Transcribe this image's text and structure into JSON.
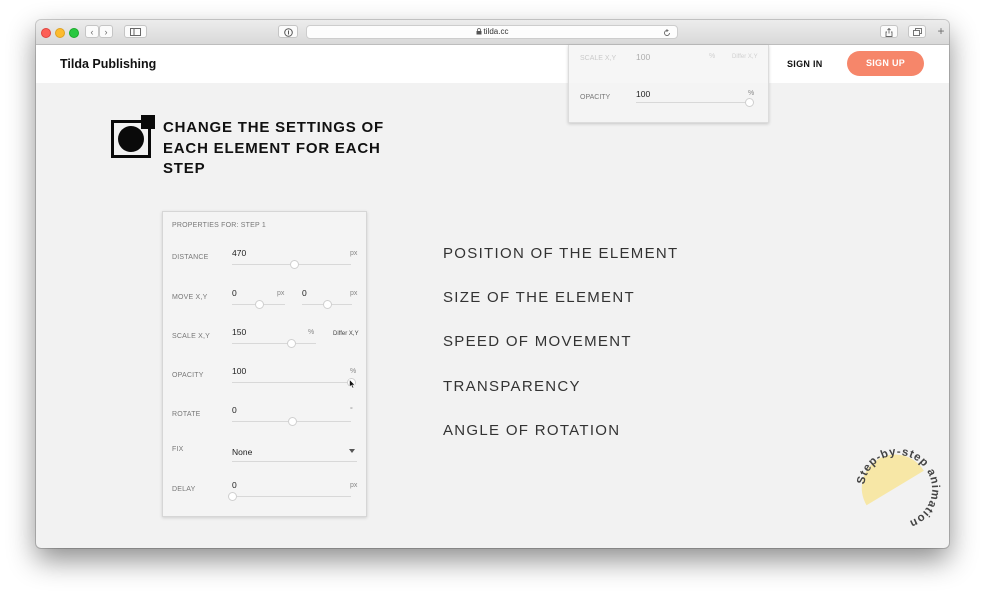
{
  "browser": {
    "url": "tilda.cc"
  },
  "header": {
    "brand": "Tilda Publishing",
    "sign_in": "SIGN IN",
    "sign_up": "SIGN UP"
  },
  "ghost_panel": {
    "rows": [
      {
        "label": "SCALE X,Y",
        "value": "100",
        "unit": "%",
        "extra": "Differ X,Y"
      },
      {
        "label": "OPACITY",
        "value": "100",
        "unit": "%"
      }
    ]
  },
  "section": {
    "heading": "CHANGE THE SETTINGS OF EACH ELEMENT FOR EACH STEP"
  },
  "panel": {
    "title": "PROPERTIES FOR: STEP 1",
    "distance": {
      "label": "DISTANCE",
      "value": "470",
      "unit": "px",
      "level": 0.52
    },
    "move": {
      "label": "MOVE X,Y",
      "x_value": "0",
      "x_unit": "px",
      "y_value": "0",
      "y_unit": "px",
      "x_level": 0.5,
      "y_level": 0.5
    },
    "scale": {
      "label": "SCALE X,Y",
      "value": "150",
      "unit": "%",
      "extra": "Differ X,Y",
      "level": 0.7
    },
    "opacity": {
      "label": "OPACITY",
      "value": "100",
      "unit": "%",
      "level": 1.0
    },
    "rotate": {
      "label": "ROTATE",
      "value": "0",
      "unit": "°",
      "level": 0.5
    },
    "fix": {
      "label": "FIX",
      "value": "None"
    },
    "delay": {
      "label": "DELAY",
      "value": "0",
      "unit": "px",
      "level": 0.0
    }
  },
  "features": [
    "POSITION OF THE ELEMENT",
    "SIZE OF THE ELEMENT",
    "SPEED OF MOVEMENT",
    "TRANSPARENCY",
    "ANGLE OF ROTATION"
  ],
  "badge": {
    "text": "Step-by-step animation",
    "color": "#f7e7a6"
  },
  "colors": {
    "accent": "#f6866a",
    "background": "#f2f2f2"
  }
}
